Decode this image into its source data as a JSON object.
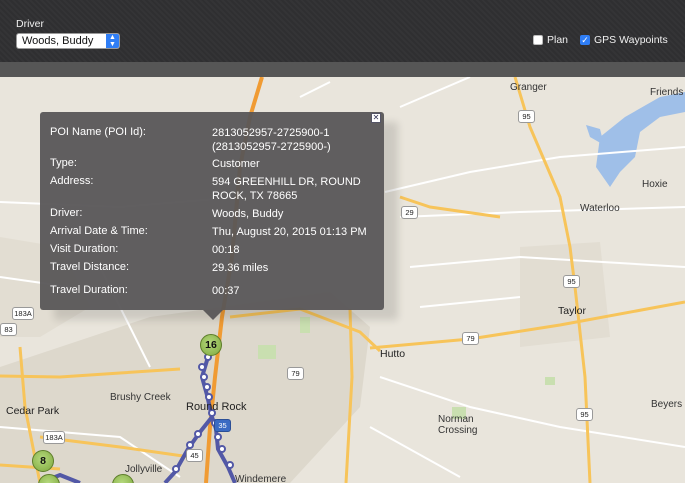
{
  "toolbar": {
    "driver_label": "Driver",
    "driver_value": "Woods, Buddy",
    "plan_label": "Plan",
    "plan_checked": false,
    "gps_label": "GPS Waypoints",
    "gps_checked": true,
    "accent_color": "#2f7ef6"
  },
  "map": {
    "places": [
      "Granger",
      "Friends",
      "Hoxie",
      "Waterloo",
      "Taylor",
      "Hutto",
      "Brushy Creek",
      "Round Rock",
      "Cedar Park",
      "Norman Crossing",
      "Jollyville",
      "Windemere",
      "Beyers"
    ],
    "shields": [
      "95",
      "29",
      "95",
      "79",
      "79",
      "95",
      "183A",
      "83",
      "183A",
      "45",
      "35"
    ]
  },
  "popup": {
    "rows": [
      {
        "label": "POI Name (POI Id):",
        "value": "2813052957-2725900-1\n(2813052957-2725900-)"
      },
      {
        "label": "Type:",
        "value": "Customer"
      },
      {
        "label": "Address:",
        "value": "594 GREENHILL DR, ROUND\nROCK, TX 78665"
      },
      {
        "label": "Driver:",
        "value": "Woods, Buddy"
      },
      {
        "label": "Arrival Date & Time:",
        "value": "Thu, August 20, 2015 01:13 PM"
      },
      {
        "label": "Visit Duration:",
        "value": "00:18"
      },
      {
        "label": "Travel Distance:",
        "value": "29.36 miles"
      },
      {
        "label": "Travel Duration:",
        "value": "00:37"
      }
    ]
  },
  "markers": [
    "16",
    "8"
  ]
}
